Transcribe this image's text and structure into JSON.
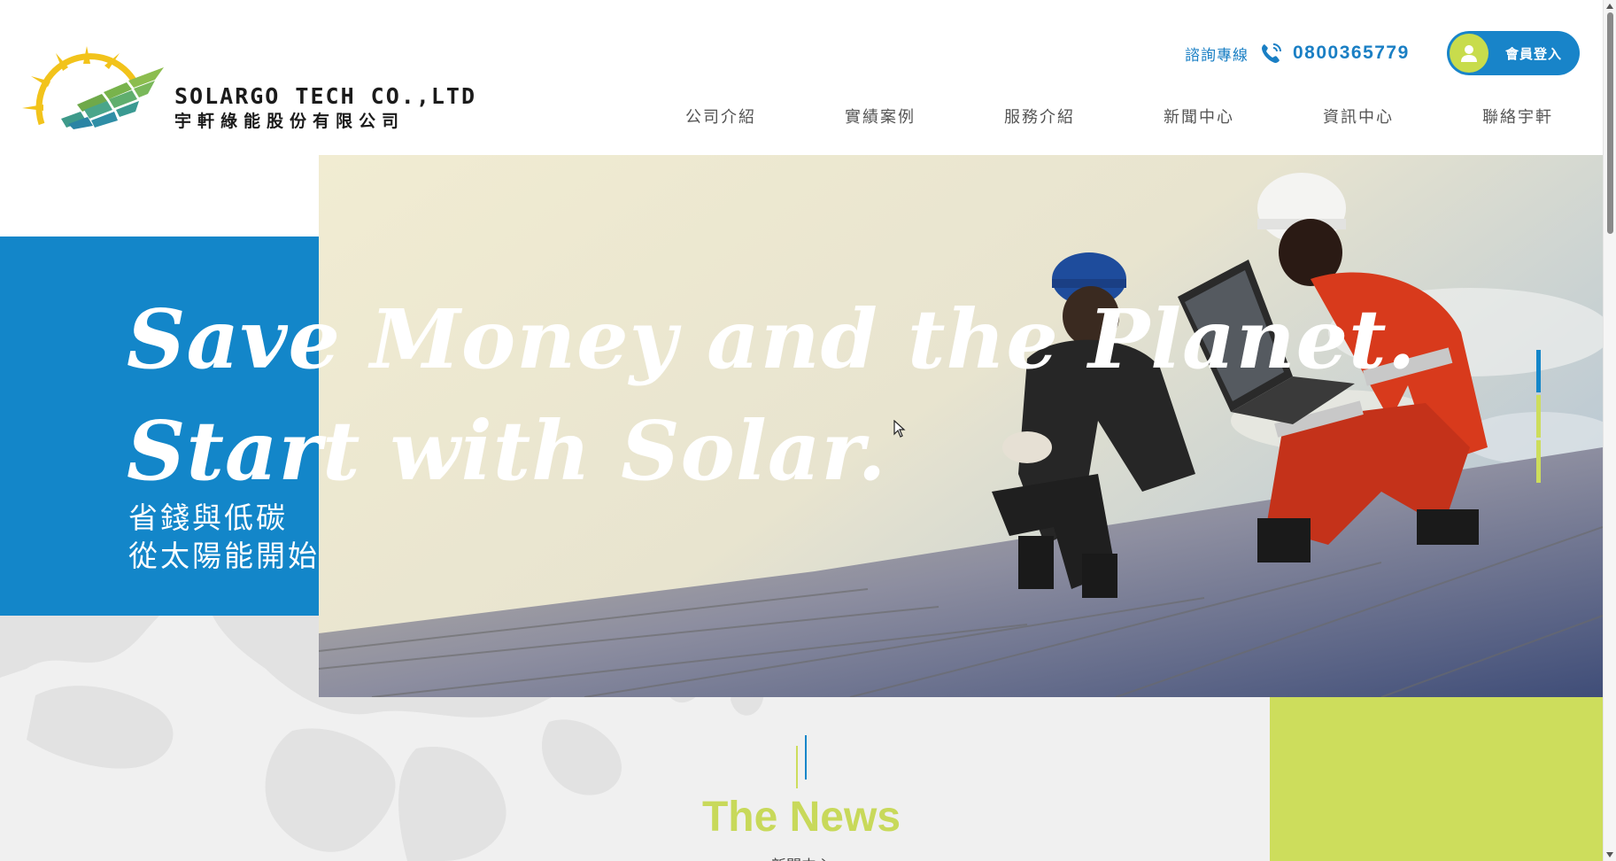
{
  "brand": {
    "name_en": "SOLARGO TECH CO.,LTD",
    "name_zh": "宇軒綠能股份有限公司",
    "logo_icon": "sun-solar-panel-logo"
  },
  "header": {
    "hotline_label": "諮詢專線",
    "hotline_number": "0800365779",
    "login_label": "會員登入"
  },
  "nav": {
    "items": [
      {
        "label": "公司介紹"
      },
      {
        "label": "實績案例"
      },
      {
        "label": "服務介紹"
      },
      {
        "label": "新聞中心"
      },
      {
        "label": "資訊中心"
      },
      {
        "label": "聯絡宇軒"
      }
    ]
  },
  "hero": {
    "title_line1": "Save Money and the Planet.",
    "title_line2": "Start with Solar.",
    "subtitle_line1": "省錢與低碳",
    "subtitle_line2": "從太陽能開始",
    "slides": [
      {
        "active": true
      },
      {
        "active": false
      },
      {
        "active": false
      }
    ]
  },
  "news": {
    "title": "The News",
    "subtitle": "新聞中心"
  },
  "colors": {
    "brand_blue": "#1386c9",
    "brand_green": "#cddd5c",
    "text_dark": "#1b1b1b",
    "nav_text": "#555555"
  }
}
